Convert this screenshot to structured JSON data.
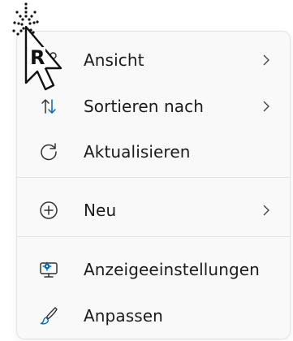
{
  "menu": {
    "items": [
      {
        "label": "Ansicht",
        "icon": "view-grid-icon",
        "has_submenu": true
      },
      {
        "label": "Sortieren nach",
        "icon": "sort-arrows-icon",
        "has_submenu": true
      },
      {
        "label": "Aktualisieren",
        "icon": "refresh-icon",
        "has_submenu": false
      },
      {
        "label": "Neu",
        "icon": "add-circle-icon",
        "has_submenu": true
      },
      {
        "label": "Anzeigeeinstellungen",
        "icon": "display-settings-icon",
        "has_submenu": false
      },
      {
        "label": "Anpassen",
        "icon": "brush-icon",
        "has_submenu": false
      }
    ]
  },
  "cursor": {
    "label": "R"
  },
  "colors": {
    "accent": "#0067c0",
    "menu_background": "#f9f9f9",
    "text": "#1b1b1b"
  }
}
